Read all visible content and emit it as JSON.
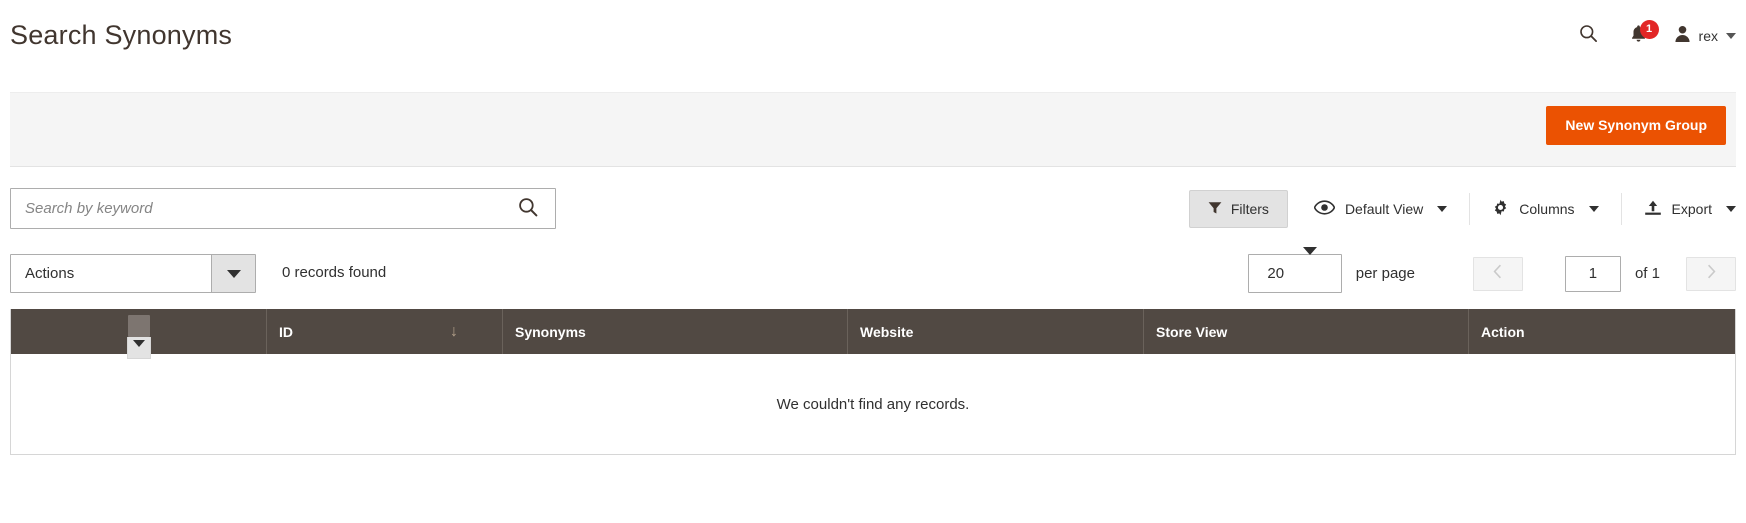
{
  "header": {
    "title": "Search Synonyms",
    "search_icon": "search-icon",
    "notifications": {
      "icon": "bell-icon",
      "count": "1",
      "badge_color": "#e22626"
    },
    "user": {
      "icon": "user-avatar-icon",
      "name": "rex",
      "caret": "chevron-down-icon"
    }
  },
  "page_actions": {
    "primary_button": "New Synonym Group",
    "primary_color": "#eb5202"
  },
  "toolbar": {
    "search": {
      "placeholder": "Search by keyword",
      "value": "",
      "icon": "search-icon"
    },
    "filters": {
      "label": "Filters",
      "icon": "funnel-icon"
    },
    "view": {
      "label": "Default View",
      "icon": "eye-icon",
      "caret": "chevron-down-icon"
    },
    "columns": {
      "label": "Columns",
      "icon": "gear-icon",
      "caret": "chevron-down-icon"
    },
    "export": {
      "label": "Export",
      "icon": "upload-icon",
      "caret": "chevron-down-icon"
    }
  },
  "toolbar2": {
    "actions": {
      "label": "Actions",
      "caret": "chevron-down-icon"
    },
    "records_found": "0 records found",
    "per_page": {
      "value": "20",
      "label": "per page",
      "caret": "chevron-down-icon"
    },
    "pagination": {
      "prev_icon": "chevron-left-icon",
      "next_icon": "chevron-right-icon",
      "current_page": "1",
      "of_label": "of 1"
    }
  },
  "grid": {
    "header_bg": "#514943",
    "mass_select": {
      "checkbox": "mass-select-checkbox",
      "toggle": "chevron-down-icon"
    },
    "columns": [
      {
        "key": "select",
        "label": ""
      },
      {
        "key": "id",
        "label": "ID",
        "sorted": true,
        "sort_icon": "↓"
      },
      {
        "key": "synonyms",
        "label": "Synonyms"
      },
      {
        "key": "website",
        "label": "Website"
      },
      {
        "key": "store_view",
        "label": "Store View"
      },
      {
        "key": "action",
        "label": "Action"
      }
    ],
    "rows": [],
    "empty_message": "We couldn't find any records."
  }
}
